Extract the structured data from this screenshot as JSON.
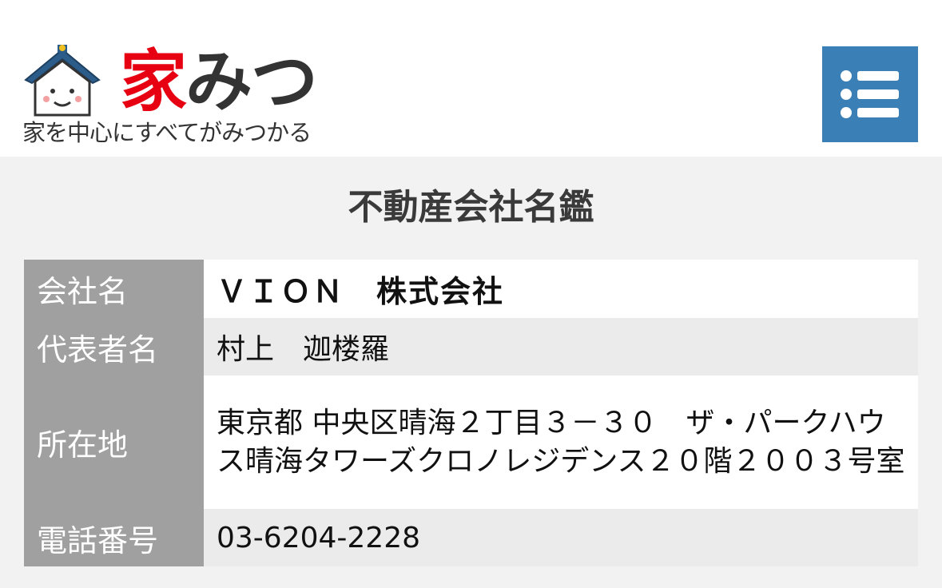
{
  "header": {
    "logo": {
      "brand_kanji": "家",
      "brand_kana": "みつ",
      "tagline": "家を中心にすべてがみつかる"
    },
    "menu_icon": "list-menu-icon",
    "menu_color": "#3a7fb5"
  },
  "page": {
    "title": "不動産会社名鑑"
  },
  "company": {
    "name_label": "会社名",
    "name_value": "ＶＩＯＮ　株式会社",
    "representative_label": "代表者名",
    "representative_value": "村上　迦楼羅",
    "address_label": "所在地",
    "address_value": "東京都 中央区晴海２丁目３－３０　ザ・パークハウス晴海タワーズクロノレジデンス２０階２００３号室",
    "phone_label": "電話番号",
    "phone_value": "03-6204-2228"
  },
  "colors": {
    "brand_red": "#e60012",
    "label_bg": "#a0a0a0",
    "page_bg": "#f2f2f2"
  }
}
